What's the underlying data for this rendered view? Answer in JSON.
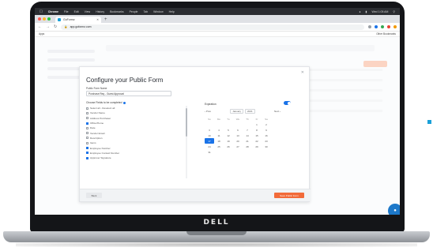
{
  "menubar": {
    "app_name": "Chrome",
    "items": [
      "File",
      "Edit",
      "View",
      "History",
      "Bookmarks",
      "People",
      "Tab",
      "Window",
      "Help"
    ],
    "status": "Wed 1:05 AM"
  },
  "browser": {
    "tab_title": "GoFormz",
    "url": "app.goformz.com",
    "bookmarks_left": "Apps",
    "bookmarks_right": "Other Bookmarks"
  },
  "modal": {
    "title": "Configure your Public Form",
    "form_name_label": "Public Form Name",
    "form_name_value": "Purchase Req - Guest Approval",
    "fields_label": "Choose Fields to be completed",
    "fields": [
      {
        "label": "Select all - Deselect all",
        "checked": false
      },
      {
        "label": "Vendor Name",
        "checked": false
      },
      {
        "label": "Address Purchaser",
        "checked": false
      },
      {
        "label": "Office/Home",
        "checked": true
      },
      {
        "label": "Date",
        "checked": false
      },
      {
        "label": "Vendor Email",
        "checked": false
      },
      {
        "label": "Description",
        "checked": false
      },
      {
        "label": "Items",
        "checked": false
      },
      {
        "label": "Employee Number",
        "checked": true
      },
      {
        "label": "Employee Contact Number",
        "checked": true
      },
      {
        "label": "Approver Signature",
        "checked": true
      }
    ],
    "expiration_label": "Expiration",
    "calendar": {
      "prev": "‹ Prev",
      "month": "January",
      "year": "2021",
      "next": "Next ›",
      "dows": [
        "Su",
        "Mo",
        "Tu",
        "We",
        "Th",
        "Fr",
        "Sa"
      ],
      "days": [
        "",
        "",
        "",
        "",
        "",
        "1",
        "2",
        "3",
        "4",
        "5",
        "6",
        "7",
        "8",
        "9",
        "10",
        "11",
        "12",
        "13",
        "14",
        "15",
        "16",
        "17",
        "18",
        "19",
        "20",
        "21",
        "22",
        "23",
        "24",
        "25",
        "26",
        "27",
        "28",
        "29",
        "30",
        "31"
      ],
      "selected": "17"
    },
    "back_label": "Back",
    "save_label": "Save Public Form"
  },
  "laptop": {
    "brand": "DELL"
  },
  "colors": {
    "accent": "#1a73e8",
    "save": "#f26b3a",
    "brand": "#1aa0d8"
  }
}
